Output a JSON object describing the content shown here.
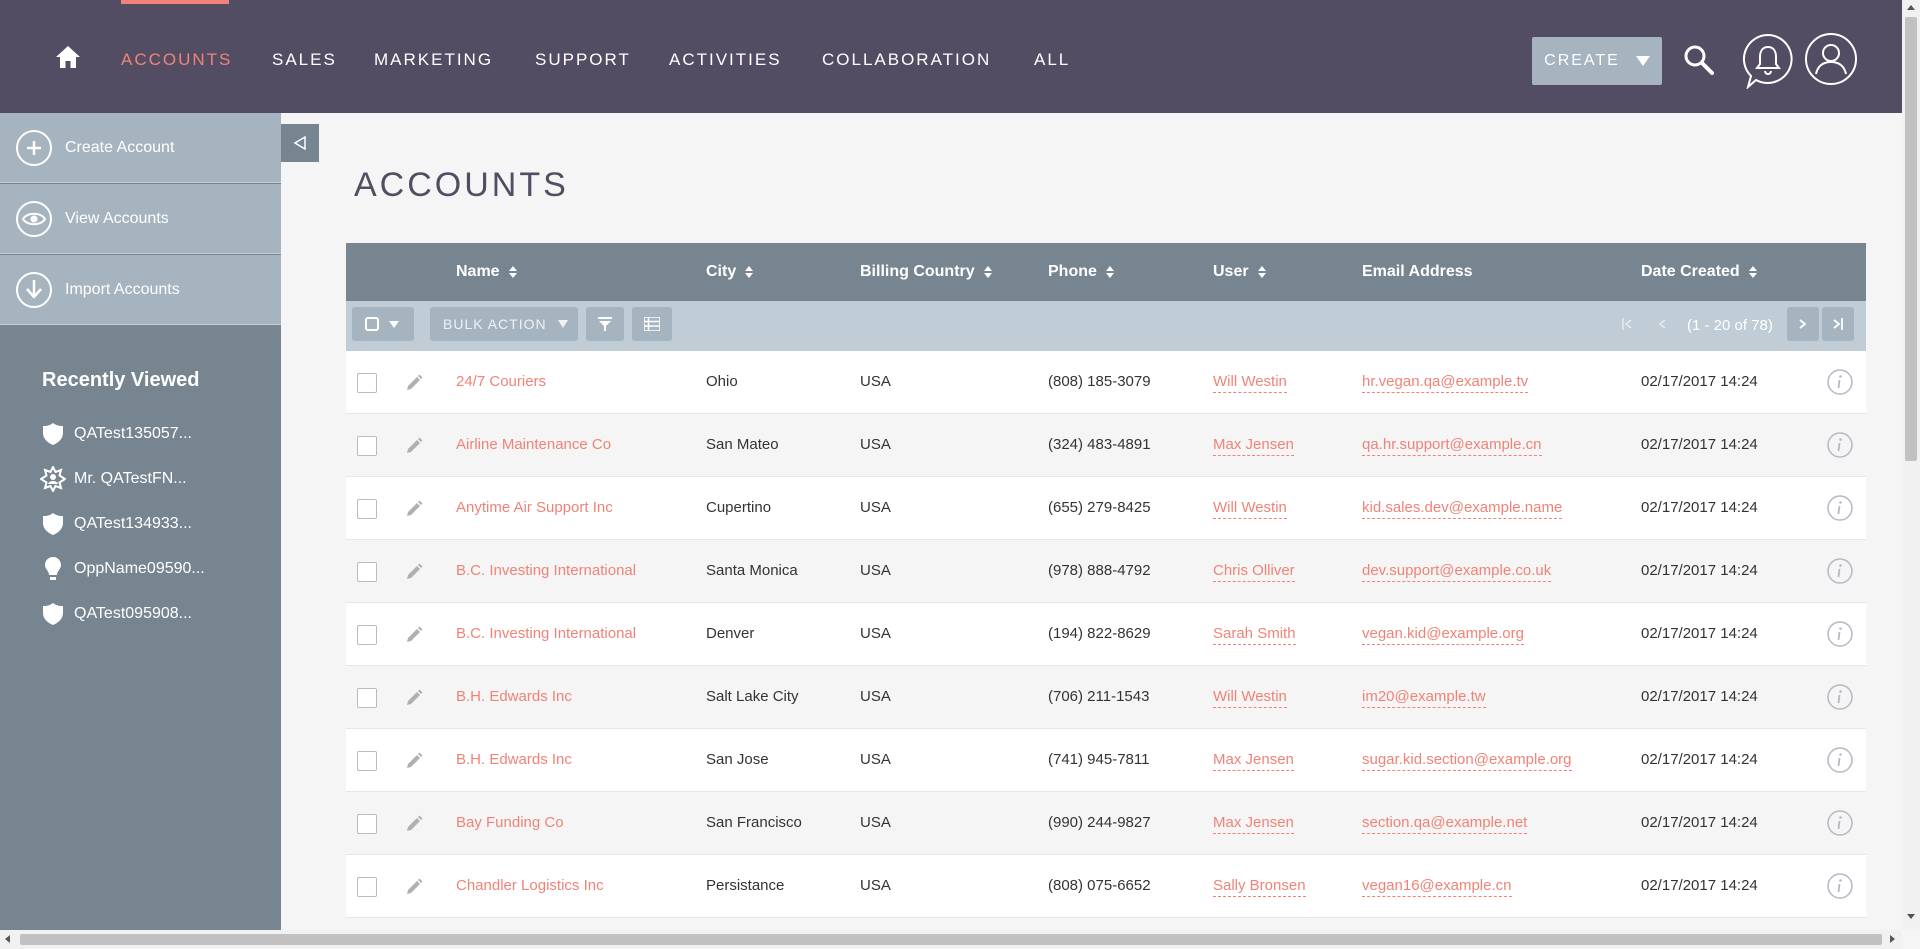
{
  "nav": {
    "items": [
      {
        "label": "ACCOUNTS"
      },
      {
        "label": "SALES"
      },
      {
        "label": "MARKETING"
      },
      {
        "label": "SUPPORT"
      },
      {
        "label": "ACTIVITIES"
      },
      {
        "label": "COLLABORATION"
      },
      {
        "label": "ALL"
      }
    ],
    "create_label": "CREATE"
  },
  "sidebar": {
    "actions": [
      {
        "label": "Create Account",
        "icon": "plus-icon"
      },
      {
        "label": "View Accounts",
        "icon": "eye-icon"
      },
      {
        "label": "Import Accounts",
        "icon": "download-icon"
      }
    ],
    "recently_viewed_title": "Recently Viewed",
    "recent": [
      {
        "label": "QATest135057...",
        "icon": "shield-icon"
      },
      {
        "label": "Mr. QATestFN...",
        "icon": "contact-star-icon"
      },
      {
        "label": "QATest134933...",
        "icon": "shield-icon"
      },
      {
        "label": "OppName09590...",
        "icon": "lightbulb-icon"
      },
      {
        "label": "QATest095908...",
        "icon": "shield-icon"
      }
    ]
  },
  "page": {
    "title": "ACCOUNTS"
  },
  "table": {
    "columns": {
      "name": "Name",
      "city": "City",
      "country": "Billing Country",
      "phone": "Phone",
      "user": "User",
      "email": "Email Address",
      "date": "Date Created"
    },
    "bulk_action_label": "BULK ACTION",
    "pagination": "(1 - 20 of 78)",
    "rows": [
      {
        "name": "24/7 Couriers",
        "city": "Ohio",
        "country": "USA",
        "phone": "(808) 185-3079",
        "user": "Will Westin",
        "email": "hr.vegan.qa@example.tv",
        "date": "02/17/2017 14:24"
      },
      {
        "name": "Airline Maintenance Co",
        "city": "San Mateo",
        "country": "USA",
        "phone": "(324) 483-4891",
        "user": "Max Jensen",
        "email": "qa.hr.support@example.cn",
        "date": "02/17/2017 14:24"
      },
      {
        "name": "Anytime Air Support Inc",
        "city": "Cupertino",
        "country": "USA",
        "phone": "(655) 279-8425",
        "user": "Will Westin",
        "email": "kid.sales.dev@example.name",
        "date": "02/17/2017 14:24"
      },
      {
        "name": "B.C. Investing International",
        "city": "Santa Monica",
        "country": "USA",
        "phone": "(978) 888-4792",
        "user": "Chris Olliver",
        "email": "dev.support@example.co.uk",
        "date": "02/17/2017 14:24"
      },
      {
        "name": "B.C. Investing International",
        "city": "Denver",
        "country": "USA",
        "phone": "(194) 822-8629",
        "user": "Sarah Smith",
        "email": "vegan.kid@example.org",
        "date": "02/17/2017 14:24"
      },
      {
        "name": "B.H. Edwards Inc",
        "city": "Salt Lake City",
        "country": "USA",
        "phone": "(706) 211-1543",
        "user": "Will Westin",
        "email": "im20@example.tw",
        "date": "02/17/2017 14:24"
      },
      {
        "name": "B.H. Edwards Inc",
        "city": "San Jose",
        "country": "USA",
        "phone": "(741) 945-7811",
        "user": "Max Jensen",
        "email": "sugar.kid.section@example.org",
        "date": "02/17/2017 14:24"
      },
      {
        "name": "Bay Funding Co",
        "city": "San Francisco",
        "country": "USA",
        "phone": "(990) 244-9827",
        "user": "Max Jensen",
        "email": "section.qa@example.net",
        "date": "02/17/2017 14:24"
      },
      {
        "name": "Chandler Logistics Inc",
        "city": "Persistance",
        "country": "USA",
        "phone": "(808) 075-6652",
        "user": "Sally Bronsen",
        "email": "vegan16@example.cn",
        "date": "02/17/2017 14:24"
      }
    ]
  },
  "colors": {
    "nav_bg": "#534d64",
    "accent": "#f08377",
    "sidebar_bg": "#778591",
    "sidebar_action_bg": "#a5b4bf",
    "table_header_bg": "#778591",
    "toolbar_bg": "#c0cdd6"
  }
}
